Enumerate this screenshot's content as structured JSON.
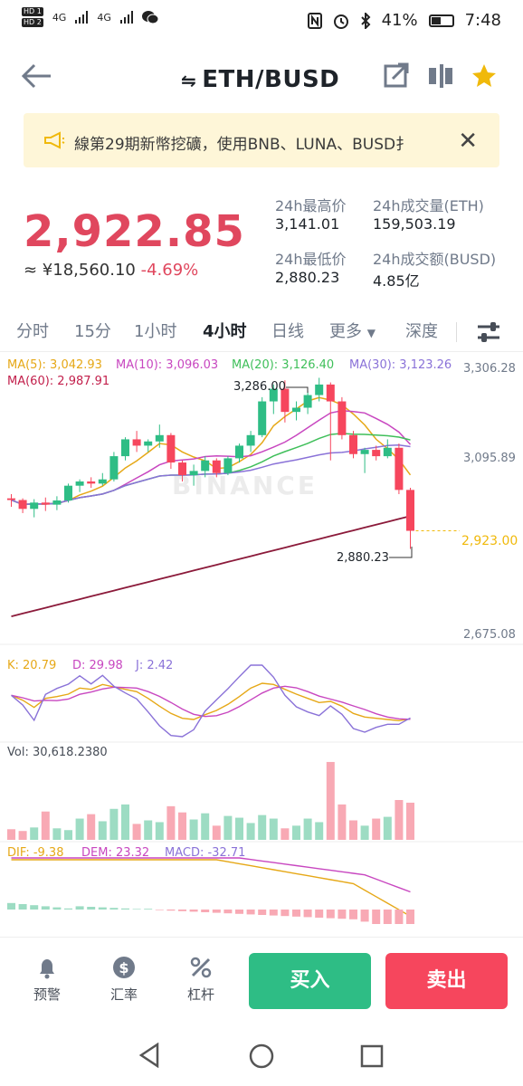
{
  "status_bar": {
    "hd1": "HD 1",
    "hd2": "HD 2",
    "net1": "4G",
    "net2": "4G",
    "battery": "41%",
    "time": "7:48"
  },
  "header": {
    "pair": "ETH/BUSD",
    "swap_glyph": "⇋"
  },
  "banner": {
    "text": "線第29期新幣挖礦，使用BNB、LUNA、BUSD扌"
  },
  "price": {
    "last": "2,922.85",
    "fiat": "≈ ¥18,560.10",
    "change": "-4.69%"
  },
  "stats": {
    "high_label": "24h最高价",
    "high": "3,141.01",
    "vol_eth_label": "24h成交量(ETH)",
    "vol_eth": "159,503.19",
    "low_label": "24h最低价",
    "low": "2,880.23",
    "vol_busd_label": "24h成交额(BUSD)",
    "vol_busd": "4.85亿"
  },
  "tabs": [
    {
      "label": "分时"
    },
    {
      "label": "15分"
    },
    {
      "label": "1小时"
    },
    {
      "label": "4小时"
    },
    {
      "label": "日线"
    },
    {
      "label": "更多"
    },
    {
      "label": "深度"
    }
  ],
  "indicators": {
    "ma5": "MA(5): 3,042.93",
    "ma10": "MA(10): 3,096.03",
    "ma20": "MA(20): 3,126.40",
    "ma30": "MA(30): 3,123.26",
    "ma60": "MA(60): 2,987.91",
    "kdj_k": "K: 20.79",
    "kdj_d": "D: 29.98",
    "kdj_j": "J: 2.42",
    "vol": "Vol: 30,618.2380",
    "macd_dif": "DIF: -9.38",
    "macd_dea": "DEM: 23.32",
    "macd": "MACD: -32.71"
  },
  "colors": {
    "up": "#2ebd85",
    "down": "#f6465d",
    "ma5": "#e6a817",
    "ma10": "#c847c0",
    "ma20": "#3fbf5a",
    "ma30": "#8a72d8",
    "ma60": "#8b1a3a"
  },
  "chart_data": {
    "type": "candlestick",
    "interval": "4小时",
    "y_ticks": [
      "3,306.28",
      "3,095.89",
      "2,675.08"
    ],
    "ylim": [
      2675.08,
      3306.28
    ],
    "current_price_label": "2,923.00",
    "high_annotation": "3,286.00",
    "low_annotation": "2,880.23",
    "candles": [
      {
        "o": 3000,
        "h": 3010,
        "l": 2980,
        "c": 2996
      },
      {
        "o": 2996,
        "h": 3000,
        "l": 2965,
        "c": 2975
      },
      {
        "o": 2975,
        "h": 2998,
        "l": 2955,
        "c": 2990
      },
      {
        "o": 2990,
        "h": 3002,
        "l": 2970,
        "c": 2985
      },
      {
        "o": 2985,
        "h": 3005,
        "l": 2972,
        "c": 2995
      },
      {
        "o": 2995,
        "h": 3035,
        "l": 2990,
        "c": 3030
      },
      {
        "o": 3030,
        "h": 3045,
        "l": 3015,
        "c": 3040
      },
      {
        "o": 3040,
        "h": 3050,
        "l": 3025,
        "c": 3035
      },
      {
        "o": 3035,
        "h": 3060,
        "l": 3030,
        "c": 3045
      },
      {
        "o": 3045,
        "h": 3110,
        "l": 3040,
        "c": 3100
      },
      {
        "o": 3100,
        "h": 3145,
        "l": 3090,
        "c": 3140
      },
      {
        "o": 3140,
        "h": 3160,
        "l": 3110,
        "c": 3125
      },
      {
        "o": 3125,
        "h": 3140,
        "l": 3110,
        "c": 3135
      },
      {
        "o": 3135,
        "h": 3175,
        "l": 3120,
        "c": 3150
      },
      {
        "o": 3150,
        "h": 3155,
        "l": 3070,
        "c": 3085
      },
      {
        "o": 3085,
        "h": 3090,
        "l": 3040,
        "c": 3055
      },
      {
        "o": 3055,
        "h": 3080,
        "l": 3030,
        "c": 3065
      },
      {
        "o": 3065,
        "h": 3100,
        "l": 3050,
        "c": 3090
      },
      {
        "o": 3090,
        "h": 3095,
        "l": 3050,
        "c": 3060
      },
      {
        "o": 3060,
        "h": 3100,
        "l": 3055,
        "c": 3095
      },
      {
        "o": 3095,
        "h": 3130,
        "l": 3085,
        "c": 3125
      },
      {
        "o": 3125,
        "h": 3160,
        "l": 3110,
        "c": 3150
      },
      {
        "o": 3150,
        "h": 3240,
        "l": 3145,
        "c": 3230
      },
      {
        "o": 3230,
        "h": 3270,
        "l": 3200,
        "c": 3260
      },
      {
        "o": 3260,
        "h": 3280,
        "l": 3180,
        "c": 3205
      },
      {
        "o": 3205,
        "h": 3230,
        "l": 3185,
        "c": 3215
      },
      {
        "o": 3215,
        "h": 3255,
        "l": 3200,
        "c": 3245
      },
      {
        "o": 3245,
        "h": 3286,
        "l": 3230,
        "c": 3270
      },
      {
        "o": 3270,
        "h": 3275,
        "l": 3090,
        "c": 3230
      },
      {
        "o": 3230,
        "h": 3240,
        "l": 3140,
        "c": 3150
      },
      {
        "o": 3150,
        "h": 3160,
        "l": 3095,
        "c": 3105
      },
      {
        "o": 3105,
        "h": 3120,
        "l": 3060,
        "c": 3115
      },
      {
        "o": 3115,
        "h": 3125,
        "l": 3090,
        "c": 3100
      },
      {
        "o": 3100,
        "h": 3140,
        "l": 3095,
        "c": 3120
      },
      {
        "o": 3120,
        "h": 3130,
        "l": 3010,
        "c": 3020
      },
      {
        "o": 3020,
        "h": 3025,
        "l": 2880.23,
        "c": 2923
      }
    ]
  }
}
